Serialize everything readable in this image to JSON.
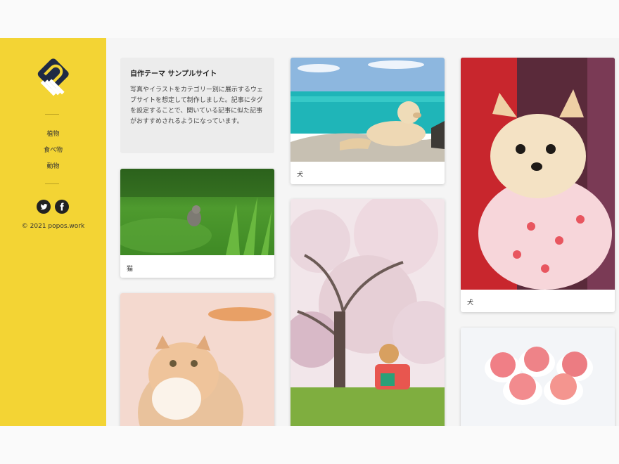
{
  "sidebar": {
    "nav": [
      {
        "label": "植物"
      },
      {
        "label": "食べ物"
      },
      {
        "label": "動物"
      }
    ],
    "social": [
      {
        "icon": "twitter-icon"
      },
      {
        "icon": "facebook-icon"
      }
    ],
    "copyright": "© 2021 popos.work"
  },
  "intro": {
    "title": "自作テーマ サンプルサイト",
    "text": "写真やイラストをカテゴリー別に展示するウェブサイトを想定して制作しました。記事にタグを設定することで、関いている記事に似た記事がおすすめされるようになっています。"
  },
  "cards": [
    {
      "caption": "猫"
    },
    {
      "caption": ""
    },
    {
      "caption": "犬"
    },
    {
      "caption": ""
    },
    {
      "caption": "犬"
    },
    {
      "caption": ""
    }
  ],
  "colors": {
    "sidebar": "#f3d434",
    "logo": "#1f2a44"
  }
}
